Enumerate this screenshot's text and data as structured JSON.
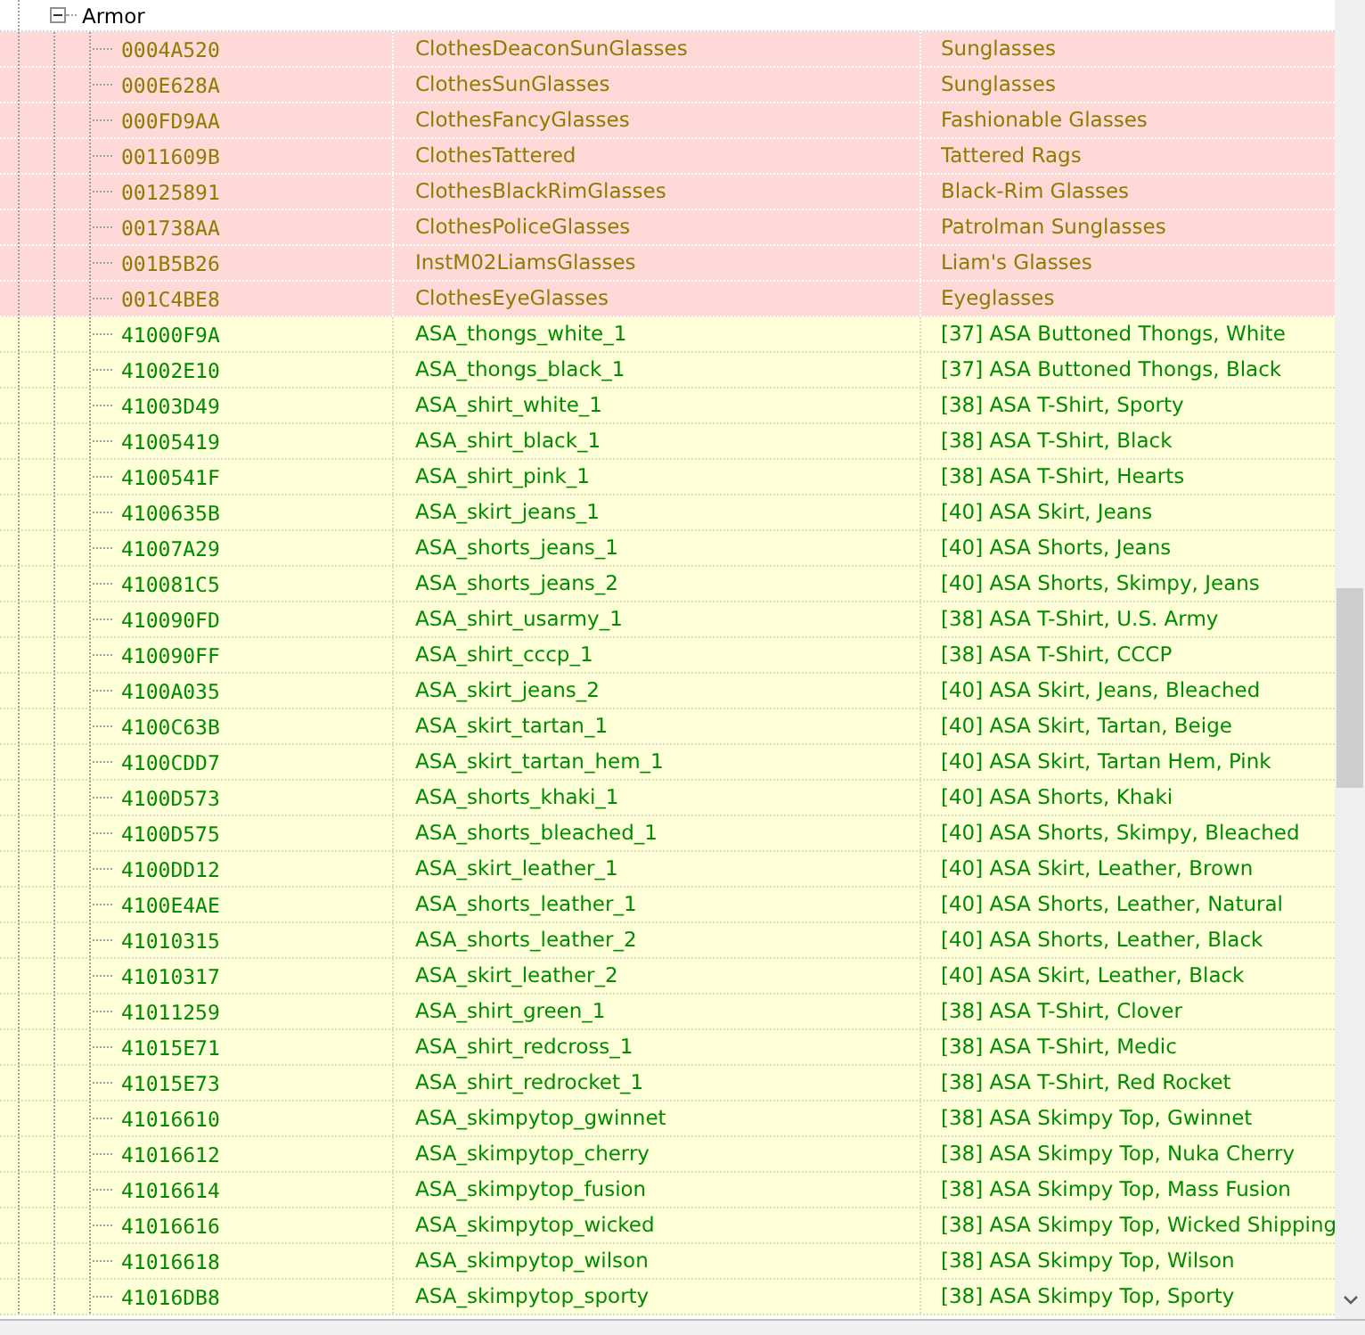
{
  "tree": {
    "label": "Armor",
    "expanded": true,
    "children": [
      {
        "form_id": "0004A520",
        "editor_id": "ClothesDeaconSunGlasses",
        "name": "Sunglasses",
        "kind": "conflict"
      },
      {
        "form_id": "000E628A",
        "editor_id": "ClothesSunGlasses",
        "name": "Sunglasses",
        "kind": "conflict"
      },
      {
        "form_id": "000FD9AA",
        "editor_id": "ClothesFancyGlasses",
        "name": "Fashionable Glasses",
        "kind": "conflict"
      },
      {
        "form_id": "0011609B",
        "editor_id": "ClothesTattered",
        "name": "Tattered Rags",
        "kind": "conflict"
      },
      {
        "form_id": "00125891",
        "editor_id": "ClothesBlackRimGlasses",
        "name": "Black-Rim Glasses",
        "kind": "conflict"
      },
      {
        "form_id": "001738AA",
        "editor_id": "ClothesPoliceGlasses",
        "name": "Patrolman Sunglasses",
        "kind": "conflict"
      },
      {
        "form_id": "001B5B26",
        "editor_id": "InstM02LiamsGlasses",
        "name": "Liam's Glasses",
        "kind": "conflict"
      },
      {
        "form_id": "001C4BE8",
        "editor_id": "ClothesEyeGlasses",
        "name": "Eyeglasses",
        "kind": "conflict"
      },
      {
        "form_id": "41000F9A",
        "editor_id": "ASA_thongs_white_1",
        "name": "[37] ASA Buttoned Thongs, White",
        "kind": "new"
      },
      {
        "form_id": "41002E10",
        "editor_id": "ASA_thongs_black_1",
        "name": "[37] ASA Buttoned Thongs, Black",
        "kind": "new"
      },
      {
        "form_id": "41003D49",
        "editor_id": "ASA_shirt_white_1",
        "name": "[38] ASA T-Shirt, Sporty",
        "kind": "new"
      },
      {
        "form_id": "41005419",
        "editor_id": "ASA_shirt_black_1",
        "name": "[38] ASA T-Shirt, Black",
        "kind": "new"
      },
      {
        "form_id": "4100541F",
        "editor_id": "ASA_shirt_pink_1",
        "name": "[38] ASA T-Shirt, Hearts",
        "kind": "new"
      },
      {
        "form_id": "4100635B",
        "editor_id": "ASA_skirt_jeans_1",
        "name": "[40] ASA Skirt, Jeans",
        "kind": "new"
      },
      {
        "form_id": "41007A29",
        "editor_id": "ASA_shorts_jeans_1",
        "name": "[40] ASA Shorts, Jeans",
        "kind": "new"
      },
      {
        "form_id": "410081C5",
        "editor_id": "ASA_shorts_jeans_2",
        "name": "[40] ASA Shorts, Skimpy, Jeans",
        "kind": "new"
      },
      {
        "form_id": "410090FD",
        "editor_id": "ASA_shirt_usarmy_1",
        "name": "[38] ASA T-Shirt, U.S. Army",
        "kind": "new"
      },
      {
        "form_id": "410090FF",
        "editor_id": "ASA_shirt_cccp_1",
        "name": "[38] ASA T-Shirt, CCCP",
        "kind": "new"
      },
      {
        "form_id": "4100A035",
        "editor_id": "ASA_skirt_jeans_2",
        "name": "[40] ASA Skirt, Jeans, Bleached",
        "kind": "new"
      },
      {
        "form_id": "4100C63B",
        "editor_id": "ASA_skirt_tartan_1",
        "name": "[40] ASA Skirt, Tartan, Beige",
        "kind": "new"
      },
      {
        "form_id": "4100CDD7",
        "editor_id": "ASA_skirt_tartan_hem_1",
        "name": "[40] ASA Skirt, Tartan Hem, Pink",
        "kind": "new"
      },
      {
        "form_id": "4100D573",
        "editor_id": "ASA_shorts_khaki_1",
        "name": "[40] ASA Shorts, Khaki",
        "kind": "new"
      },
      {
        "form_id": "4100D575",
        "editor_id": "ASA_shorts_bleached_1",
        "name": "[40] ASA Shorts, Skimpy, Bleached",
        "kind": "new"
      },
      {
        "form_id": "4100DD12",
        "editor_id": "ASA_skirt_leather_1",
        "name": "[40] ASA Skirt, Leather, Brown",
        "kind": "new"
      },
      {
        "form_id": "4100E4AE",
        "editor_id": "ASA_shorts_leather_1",
        "name": "[40] ASA Shorts, Leather, Natural",
        "kind": "new"
      },
      {
        "form_id": "41010315",
        "editor_id": "ASA_shorts_leather_2",
        "name": "[40] ASA Shorts, Leather, Black",
        "kind": "new"
      },
      {
        "form_id": "41010317",
        "editor_id": "ASA_skirt_leather_2",
        "name": "[40] ASA Skirt, Leather, Black",
        "kind": "new"
      },
      {
        "form_id": "41011259",
        "editor_id": "ASA_shirt_green_1",
        "name": "[38] ASA T-Shirt, Clover",
        "kind": "new"
      },
      {
        "form_id": "41015E71",
        "editor_id": "ASA_shirt_redcross_1",
        "name": "[38] ASA T-Shirt, Medic",
        "kind": "new"
      },
      {
        "form_id": "41015E73",
        "editor_id": "ASA_shirt_redrocket_1",
        "name": "[38] ASA T-Shirt, Red Rocket",
        "kind": "new"
      },
      {
        "form_id": "41016610",
        "editor_id": "ASA_skimpytop_gwinnet",
        "name": "[38] ASA Skimpy Top, Gwinnet",
        "kind": "new"
      },
      {
        "form_id": "41016612",
        "editor_id": "ASA_skimpytop_cherry",
        "name": "[38] ASA Skimpy Top, Nuka Cherry",
        "kind": "new"
      },
      {
        "form_id": "41016614",
        "editor_id": "ASA_skimpytop_fusion",
        "name": "[38] ASA Skimpy Top, Mass Fusion",
        "kind": "new"
      },
      {
        "form_id": "41016616",
        "editor_id": "ASA_skimpytop_wicked",
        "name": "[38] ASA Skimpy Top, Wicked Shipping",
        "kind": "new"
      },
      {
        "form_id": "41016618",
        "editor_id": "ASA_skimpytop_wilson",
        "name": "[38] ASA Skimpy Top, Wilson",
        "kind": "new"
      },
      {
        "form_id": "41016DB8",
        "editor_id": "ASA_skimpytop_sporty",
        "name": "[38] ASA Skimpy Top, Sporty",
        "kind": "new"
      }
    ]
  }
}
